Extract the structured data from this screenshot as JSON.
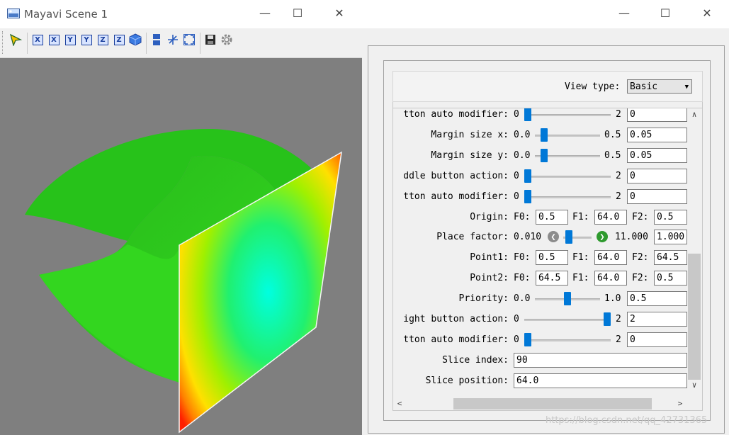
{
  "left_window": {
    "title": "Mayavi Scene 1",
    "controls": {
      "minimize": "—",
      "maximize": "☐",
      "close": "✕"
    },
    "toolbar": {
      "icons": [
        "cursor-icon",
        "view-x-pos-icon",
        "view-x-neg-icon",
        "view-y-pos-icon",
        "view-y-neg-icon",
        "view-z-pos-icon",
        "view-z-neg-icon",
        "isometric-icon",
        "parallel-projection-icon",
        "axes-icon",
        "fullscreen-icon",
        "save-icon",
        "settings-icon"
      ],
      "x": "X",
      "y": "Y",
      "z": "Z"
    }
  },
  "right_window": {
    "controls": {
      "minimize": "—",
      "maximize": "☐",
      "close": "✕"
    },
    "view_type": {
      "label": "View type:",
      "value": "Basic"
    },
    "rows": [
      {
        "kind": "slider",
        "label": "tton auto modifier:",
        "min": "0",
        "max": "2",
        "value": "0",
        "fraction": 0.0
      },
      {
        "kind": "slider",
        "label": "Margin size x:",
        "min": "0.0",
        "max": "0.5",
        "value": "0.05",
        "fraction": 0.1
      },
      {
        "kind": "slider",
        "label": "Margin size y:",
        "min": "0.0",
        "max": "0.5",
        "value": "0.05",
        "fraction": 0.1
      },
      {
        "kind": "slider",
        "label": "ddle button action:",
        "min": "0",
        "max": "2",
        "value": "0",
        "fraction": 0.0
      },
      {
        "kind": "slider",
        "label": "tton auto modifier:",
        "min": "0",
        "max": "2",
        "value": "0",
        "fraction": 0.0
      },
      {
        "kind": "triple",
        "label": "Origin:",
        "f0_label": "F0:",
        "f0": "0.5",
        "f1_label": "F1:",
        "f1": "64.0",
        "f2_label": "F2:",
        "f2": "0.5"
      },
      {
        "kind": "range",
        "label": "Place factor:",
        "min": "0.010",
        "max": "11.000",
        "value": "1.000"
      },
      {
        "kind": "triple",
        "label": "Point1:",
        "f0_label": "F0:",
        "f0": "0.5",
        "f1_label": "F1:",
        "f1": "64.0",
        "f2_label": "F2:",
        "f2": "64.5"
      },
      {
        "kind": "triple",
        "label": "Point2:",
        "f0_label": "F0:",
        "f0": "64.5",
        "f1_label": "F1:",
        "f1": "64.0",
        "f2_label": "F2:",
        "f2": "0.5"
      },
      {
        "kind": "slider",
        "label": "Priority:",
        "min": "0.0",
        "max": "1.0",
        "value": "0.5",
        "fraction": 0.5
      },
      {
        "kind": "slider",
        "label": "ight button action:",
        "min": "0",
        "max": "2",
        "value": "2",
        "fraction": 1.0
      },
      {
        "kind": "slider",
        "label": "tton auto modifier:",
        "min": "0",
        "max": "2",
        "value": "0",
        "fraction": 0.0
      },
      {
        "kind": "text",
        "label": "Slice index:",
        "value": "90"
      },
      {
        "kind": "text",
        "label": "Slice position:",
        "value": "64.0"
      }
    ]
  },
  "watermark": "https://blog.csdn.net/qq_42731365",
  "colors": {
    "slider": "#0078d7",
    "scene_bg": "#7f7f7f",
    "surface": "#2fd11a"
  }
}
